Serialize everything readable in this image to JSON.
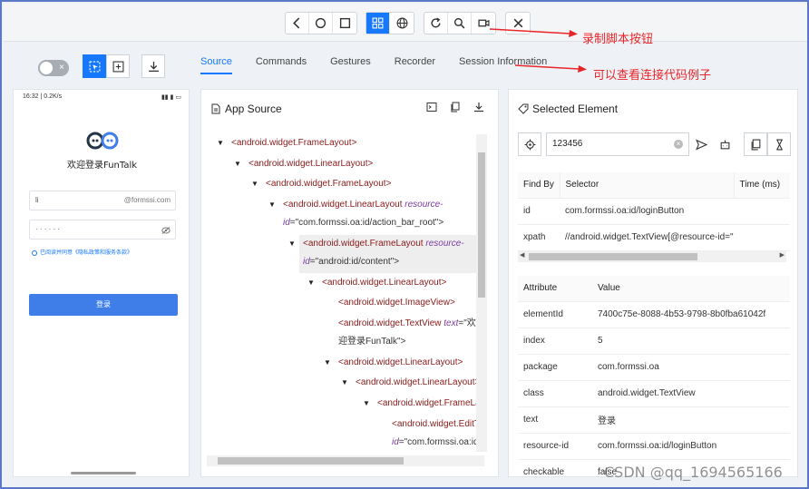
{
  "toolbar": {
    "groups": [
      [
        "chevron-left-icon",
        "circle-icon",
        "square-icon"
      ],
      [
        "grid-icon",
        "globe-icon"
      ],
      [
        "refresh-icon",
        "search-icon",
        "video-icon"
      ],
      [
        "close-icon"
      ]
    ],
    "active_icon": "grid-icon"
  },
  "annotations": {
    "record_button": "录制脚本按钮",
    "code_example": "可以查看连接代码例子"
  },
  "controls": {
    "toggle_icon": "×"
  },
  "tabs": [
    "Source",
    "Commands",
    "Gestures",
    "Recorder",
    "Session Information"
  ],
  "active_tab": "Source",
  "device": {
    "status_left": "16:32 | 0.2K/s",
    "status_right": "▮▮ ▮ ▭",
    "welcome": "欢迎登录FunTalk",
    "username": "li",
    "username_suffix": "@formssi.com",
    "password": "· · · · · ·",
    "consent": "已阅读并同意《隐私政策和服务条款》",
    "login_button": "登录"
  },
  "source_panel": {
    "title": "App Source",
    "tree": [
      {
        "text": "<android.widget.FrameLayout>"
      },
      {
        "text": "<android.widget.LinearLayout>"
      },
      {
        "text": "<android.widget.FrameLayout>"
      },
      {
        "text": "<android.widget.LinearLayout ",
        "attr": "resource-",
        "cont_attr": "id",
        "cont_val": "=\"com.formssi.oa:id/action_bar_root\">"
      },
      {
        "text": "<android.widget.FrameLayout ",
        "attr": "resource-",
        "cont_attr": "id",
        "cont_val": "=\"android:id/content\">"
      },
      {
        "text": "<android.widget.LinearLayout>"
      },
      {
        "text": "<android.widget.ImageView>"
      },
      {
        "text": "<android.widget.TextView ",
        "attr": "text",
        "val": "=\"欢",
        "cont_val": "迎登录FunTalk\">"
      },
      {
        "text": "<android.widget.LinearLayout>"
      },
      {
        "text": "<android.widget.LinearLayout>"
      },
      {
        "text": "<android.widget.FrameLay"
      },
      {
        "text": "<android.widget.EditT",
        "cont_attr": "id",
        "cont_val": "=\"com.formssi.oa:id,"
      }
    ]
  },
  "selected_panel": {
    "title": "Selected Element",
    "search_value": "123456",
    "clear_glyph": "×",
    "find_headers": [
      "Find By",
      "Selector",
      "Time (ms)"
    ],
    "find_rows": [
      [
        "id",
        "com.formssi.oa:id/loginButton",
        ""
      ],
      [
        "xpath",
        "//android.widget.TextView[@resource-id=\"c",
        ""
      ]
    ],
    "attr_headers": [
      "Attribute",
      "Value"
    ],
    "attr_rows": [
      [
        "elementId",
        "7400c75e-8088-4b53-9798-8b0fba61042f"
      ],
      [
        "index",
        "5"
      ],
      [
        "package",
        "com.formssi.oa"
      ],
      [
        "class",
        "android.widget.TextView"
      ],
      [
        "text",
        "登录"
      ],
      [
        "resource-id",
        "com.formssi.oa:id/loginButton"
      ],
      [
        "checkable",
        "false"
      ]
    ]
  },
  "watermark": "CSDN @qq_1694565166"
}
